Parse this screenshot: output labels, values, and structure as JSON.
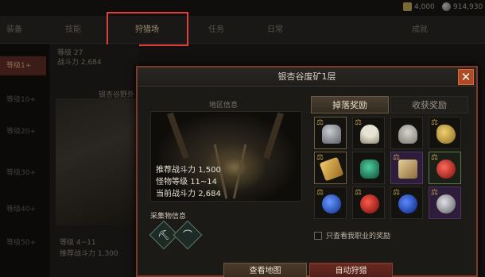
{
  "topbar": {
    "currency_gold": "4,000",
    "currency_silver": "914,930"
  },
  "tabs": [
    {
      "label": "装备"
    },
    {
      "label": "技能"
    },
    {
      "label": "狩猎场"
    },
    {
      "label": "任务"
    },
    {
      "label": "日常"
    },
    {
      "label": "成就"
    }
  ],
  "left_menu": [
    {
      "label": "等级1+"
    },
    {
      "label": "等级10+"
    },
    {
      "label": "等级20+"
    },
    {
      "label": "等级30+"
    },
    {
      "label": "等级40+"
    },
    {
      "label": "等级50+"
    }
  ],
  "background_panel": {
    "level_line": "等级 27",
    "power_line": "战斗力 2,684",
    "area_name": "银杏谷野外",
    "level_range": "等级 4~11",
    "recommended_power": "推荐战斗力 1,300"
  },
  "modal": {
    "title": "银杏谷废矿1层",
    "close_label": "✕",
    "region_info_label": "地区信息",
    "stats": {
      "recommended_power_label": "推荐战斗力",
      "recommended_power_value": "1,500",
      "monster_level_label": "怪物等级",
      "monster_level_value": "11~14",
      "current_power_label": "当前战斗力",
      "current_power_value": "2,684"
    },
    "gather_label": "采集物信息",
    "gather_icons": [
      "pickaxe-icon",
      "sickle-icon"
    ],
    "reward_tabs": [
      {
        "label": "掉落奖励",
        "active": true
      },
      {
        "label": "收获奖励",
        "active": false
      }
    ],
    "reward_items": [
      {
        "name": "helmet-icon",
        "color": "#8a8f96"
      },
      {
        "name": "mushroom-icon",
        "color": "#c9c6b8"
      },
      {
        "name": "armor-icon",
        "color": "#b8b5ae"
      },
      {
        "name": "gold-ore-icon",
        "color": "#c9a54a"
      },
      {
        "name": "golden-scroll-icon",
        "color": "#d4a24a"
      },
      {
        "name": "green-gem-icon",
        "color": "#2f8a6a"
      },
      {
        "name": "map-scroll-icon",
        "color": "#c8aa6a"
      },
      {
        "name": "red-potion-icon",
        "color": "#c0282a"
      },
      {
        "name": "blue-potion-icon",
        "color": "#2d5ad4"
      },
      {
        "name": "red-flask-icon",
        "color": "#c32b2b"
      },
      {
        "name": "blue-flask-icon",
        "color": "#2b4fc8"
      },
      {
        "name": "silver-coin-icon",
        "color": "#a0a0a6"
      }
    ],
    "checkbox_label": "只查看我职业的奖励",
    "buttons": {
      "view_map": "查看地图",
      "auto_hunt": "自动狩猎"
    }
  }
}
